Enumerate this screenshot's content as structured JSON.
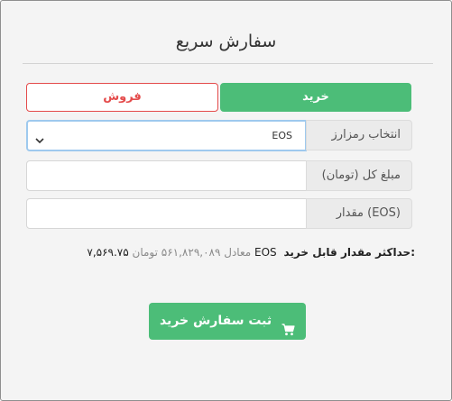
{
  "panel": {
    "title": "سفارش سریع"
  },
  "tabs": {
    "sell_label": "فروش",
    "buy_label": "خرید",
    "active": "buy"
  },
  "form": {
    "currency_label": "انتخاب رمزارز",
    "currency_value": "EOS",
    "total_label": "مبلغ کل (تومان)",
    "total_value": "",
    "amount_label": "مقدار (EOS)",
    "amount_value": ""
  },
  "max_info": {
    "label": "حداکثر مقدار قابل خرید:",
    "amount": "۷,۵۶۹.۷۵ EOS",
    "equivalent": "معادل ۵۶۱,۸۲۹,۰۸۹ تومان"
  },
  "submit": {
    "label": "ثبت سفارش خرید",
    "icon": "cart-icon"
  },
  "colors": {
    "buy": "#4cbd78",
    "sell": "#e44b4b",
    "focus_border": "#9ec9ee"
  }
}
